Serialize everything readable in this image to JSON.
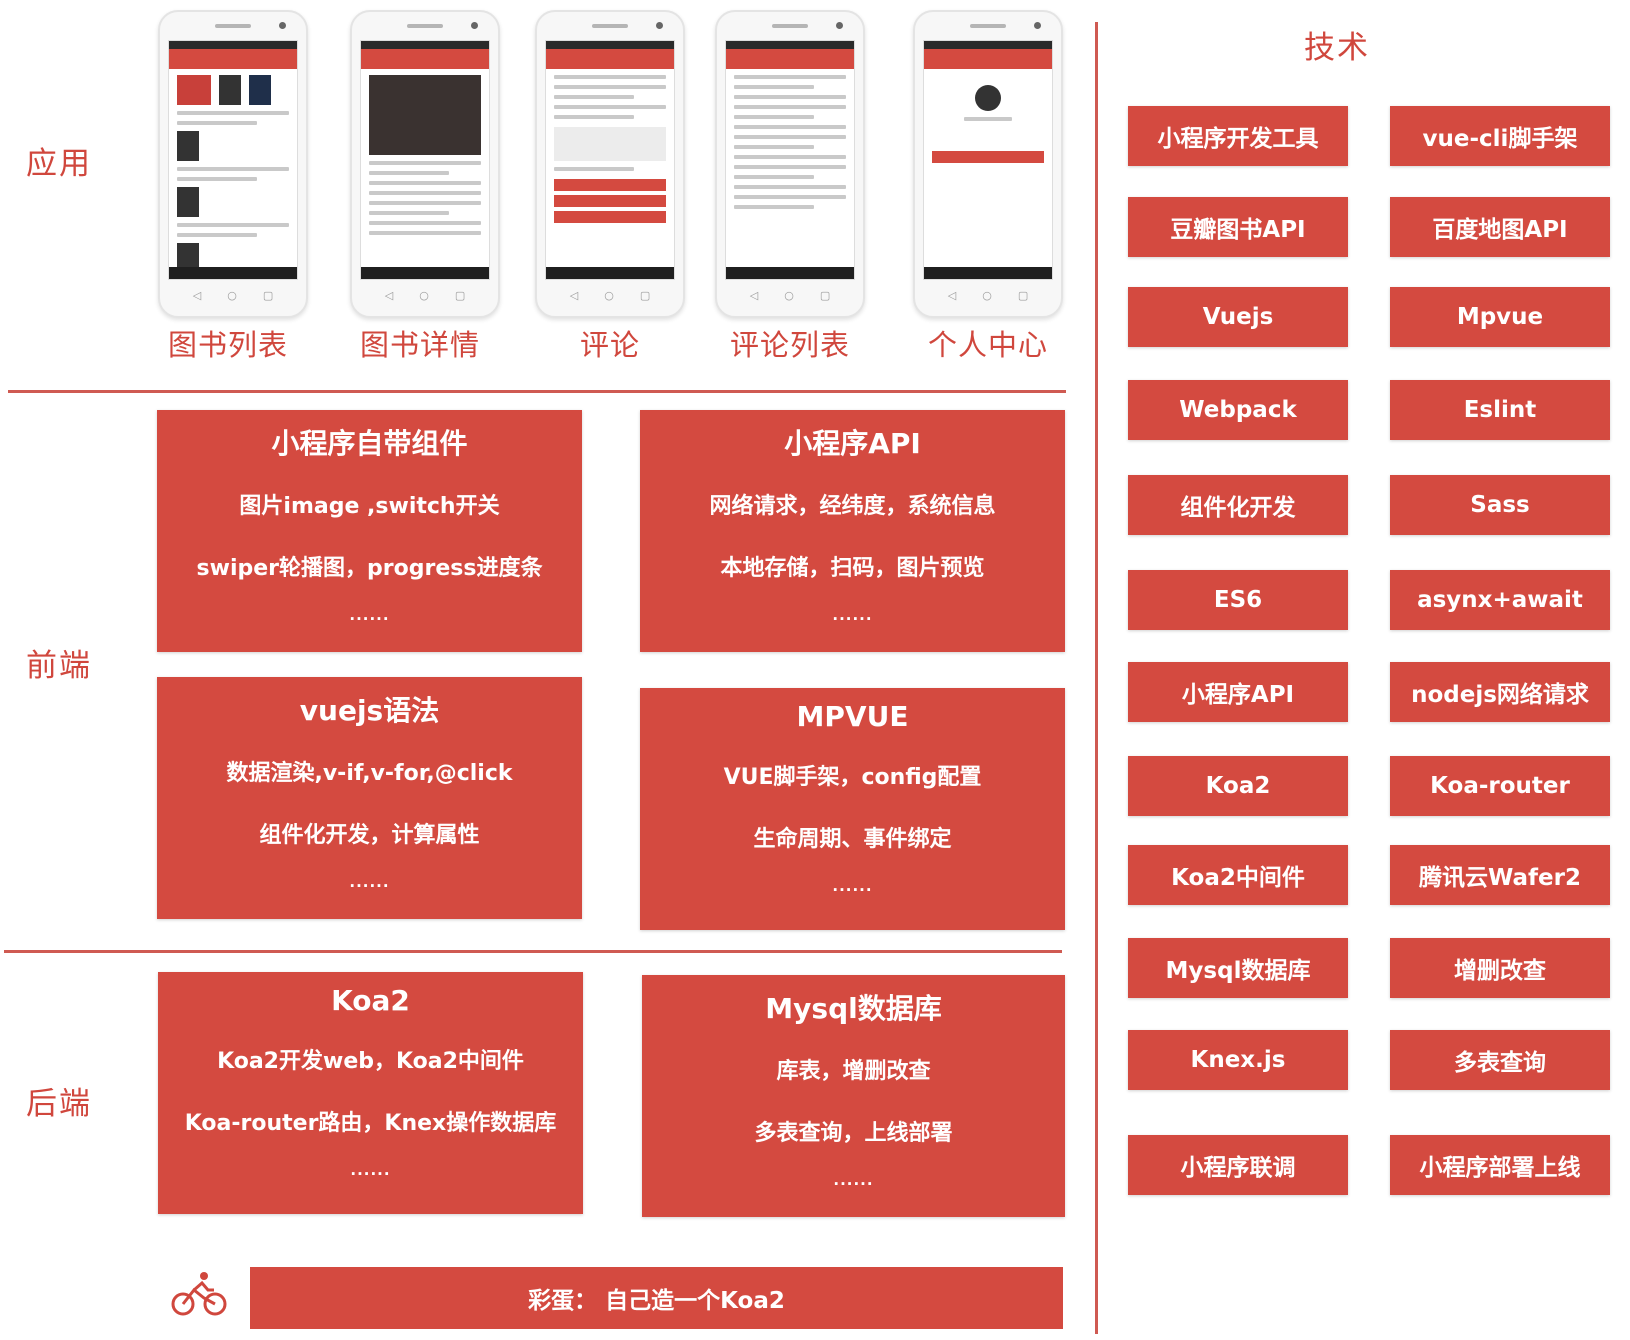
{
  "sections": {
    "app": "应用",
    "frontend": "前端",
    "backend": "后端",
    "tech": "技术"
  },
  "phones": [
    {
      "caption": "图书列表"
    },
    {
      "caption": "图书详情"
    },
    {
      "caption": "评论"
    },
    {
      "caption": "评论列表"
    },
    {
      "caption": "个人中心"
    }
  ],
  "frontend_cards": [
    {
      "title": "小程序自带组件",
      "lines": [
        "图片image ,switch开关",
        "swiper轮播图，progress进度条"
      ],
      "more": "......"
    },
    {
      "title": "小程序API",
      "lines": [
        "网络请求，经纬度，系统信息",
        "本地存储，扫码，图片预览"
      ],
      "more": "......"
    },
    {
      "title": "vuejs语法",
      "lines": [
        "数据渲染,v-if,v-for,@click",
        "组件化开发，计算属性"
      ],
      "more": "......"
    },
    {
      "title": "MPVUE",
      "lines": [
        "VUE脚手架，config配置",
        "生命周期、事件绑定"
      ],
      "more": "......"
    }
  ],
  "backend_cards": [
    {
      "title": "Koa2",
      "lines": [
        "Koa2开发web，Koa2中间件",
        "Koa-router路由，Knex操作数据库"
      ],
      "more": "......"
    },
    {
      "title": "Mysql数据库",
      "lines": [
        "库表，增删改查",
        "多表查询，上线部署"
      ],
      "more": "......"
    }
  ],
  "tech_items": [
    "小程序开发工具",
    "vue-cli脚手架",
    "豆瓣图书API",
    "百度地图API",
    "Vuejs",
    "Mpvue",
    "Webpack",
    "Eslint",
    "组件化开发",
    "Sass",
    "ES6",
    "asynx+await",
    "小程序API",
    "nodejs网络请求",
    "Koa2",
    "Koa-router",
    "Koa2中间件",
    "腾讯云Wafer2",
    "Mysql数据库",
    "增删改查",
    "Knex.js",
    "多表查询",
    "小程序联调",
    "小程序部署上线"
  ],
  "easter_egg": "彩蛋：  自己造一个Koa2",
  "icons": {
    "bike": "bicycle-icon"
  },
  "colors": {
    "accent": "#d44a40",
    "label": "#d0473d"
  }
}
